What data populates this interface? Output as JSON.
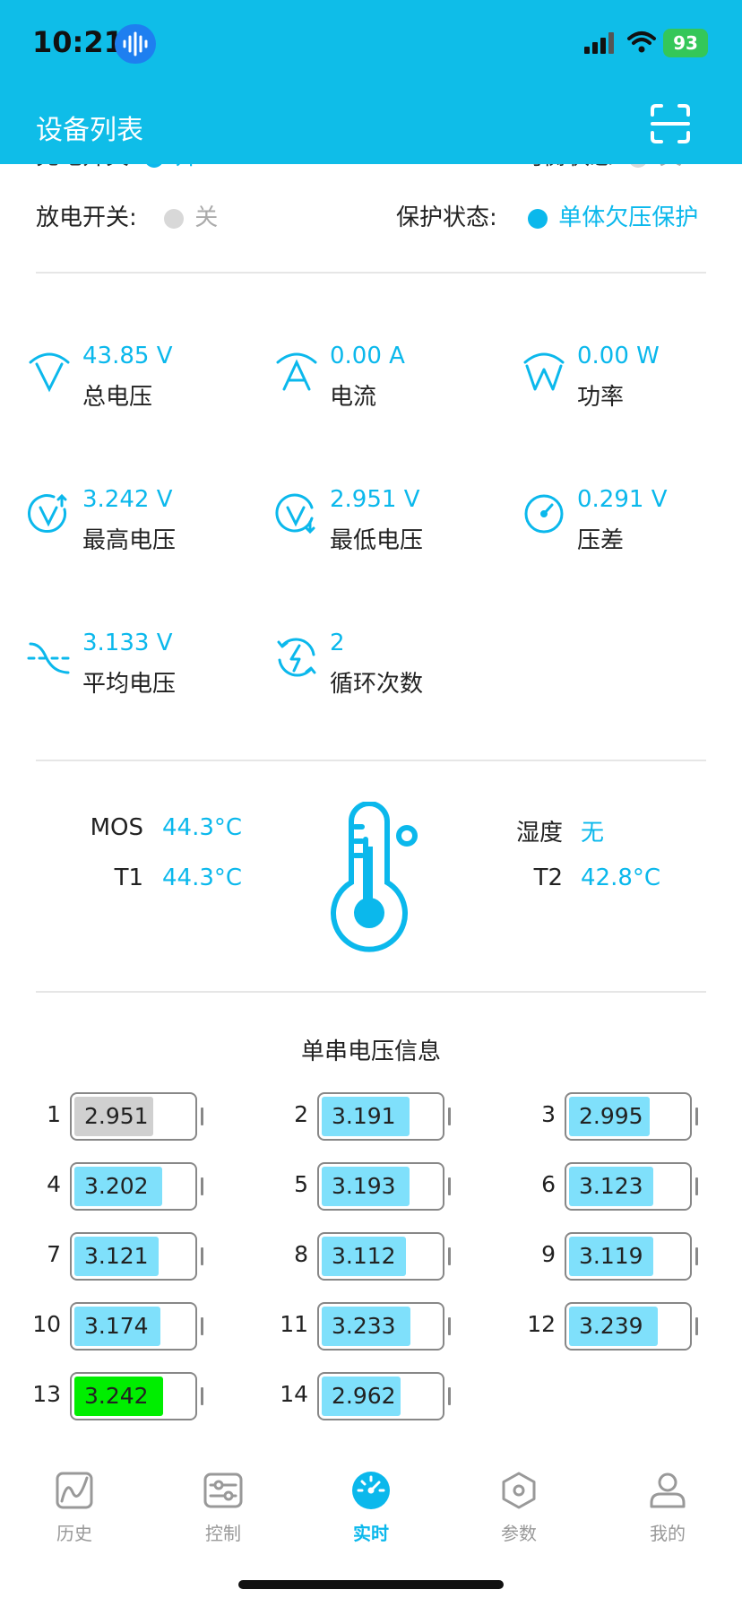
{
  "status": {
    "time": "10:21",
    "battery": "93"
  },
  "nav": {
    "title": "设备列表"
  },
  "switches": {
    "charge_label": "充电开关:",
    "charge_value": "开",
    "balance_label": "均衡状态:",
    "balance_value": "关",
    "discharge_label": "放电开关:",
    "discharge_value": "关",
    "protect_label": "保护状态:",
    "protect_value": "单体欠压保护"
  },
  "metrics": [
    {
      "value": "43.85 V",
      "label": "总电压",
      "icon": "voltage-v-icon"
    },
    {
      "value": "0.00 A",
      "label": "电流",
      "icon": "current-a-icon"
    },
    {
      "value": "0.00 W",
      "label": "功率",
      "icon": "power-w-icon"
    },
    {
      "value": "3.242 V",
      "label": "最高电压",
      "icon": "max-voltage-icon"
    },
    {
      "value": "2.951 V",
      "label": "最低电压",
      "icon": "min-voltage-icon"
    },
    {
      "value": "0.291 V",
      "label": "压差",
      "icon": "gauge-icon"
    },
    {
      "value": "3.133 V",
      "label": "平均电压",
      "icon": "wave-icon"
    },
    {
      "value": "2",
      "label": "循环次数",
      "icon": "cycle-icon"
    }
  ],
  "temps": {
    "mos_label": "MOS",
    "mos_value": "44.3°C",
    "t1_label": "T1",
    "t1_value": "44.3°C",
    "humidity_label": "湿度",
    "humidity_value": "无",
    "t2_label": "T2",
    "t2_value": "42.8°C"
  },
  "cells_title": "单串电压信息",
  "cells": [
    {
      "n": "1",
      "v": "2.951",
      "level": 0.66,
      "color": "#d0d0d0"
    },
    {
      "n": "2",
      "v": "3.191",
      "level": 0.73,
      "color": "#7fe0fb"
    },
    {
      "n": "3",
      "v": "2.995",
      "level": 0.67,
      "color": "#7fe0fb"
    },
    {
      "n": "4",
      "v": "3.202",
      "level": 0.73,
      "color": "#7fe0fb"
    },
    {
      "n": "5",
      "v": "3.193",
      "level": 0.73,
      "color": "#7fe0fb"
    },
    {
      "n": "6",
      "v": "3.123",
      "level": 0.7,
      "color": "#7fe0fb"
    },
    {
      "n": "7",
      "v": "3.121",
      "level": 0.7,
      "color": "#7fe0fb"
    },
    {
      "n": "8",
      "v": "3.112",
      "level": 0.7,
      "color": "#7fe0fb"
    },
    {
      "n": "9",
      "v": "3.119",
      "level": 0.7,
      "color": "#7fe0fb"
    },
    {
      "n": "10",
      "v": "3.174",
      "level": 0.72,
      "color": "#7fe0fb"
    },
    {
      "n": "11",
      "v": "3.233",
      "level": 0.74,
      "color": "#7fe0fb"
    },
    {
      "n": "12",
      "v": "3.239",
      "level": 0.74,
      "color": "#7fe0fb"
    },
    {
      "n": "13",
      "v": "3.242",
      "level": 0.74,
      "color": "#00ee00"
    },
    {
      "n": "14",
      "v": "2.962",
      "level": 0.66,
      "color": "#7fe0fb"
    }
  ],
  "tabs": [
    {
      "label": "历史",
      "icon": "history-chart-icon",
      "active": false
    },
    {
      "label": "控制",
      "icon": "sliders-icon",
      "active": false
    },
    {
      "label": "实时",
      "icon": "speedometer-icon",
      "active": true
    },
    {
      "label": "参数",
      "icon": "hexagon-nut-icon",
      "active": false
    },
    {
      "label": "我的",
      "icon": "user-icon",
      "active": false
    }
  ],
  "colors": {
    "accent": "#0bb8ec",
    "header": "#0fbde8",
    "min_cell": "#d0d0d0",
    "max_cell": "#00ee00"
  }
}
